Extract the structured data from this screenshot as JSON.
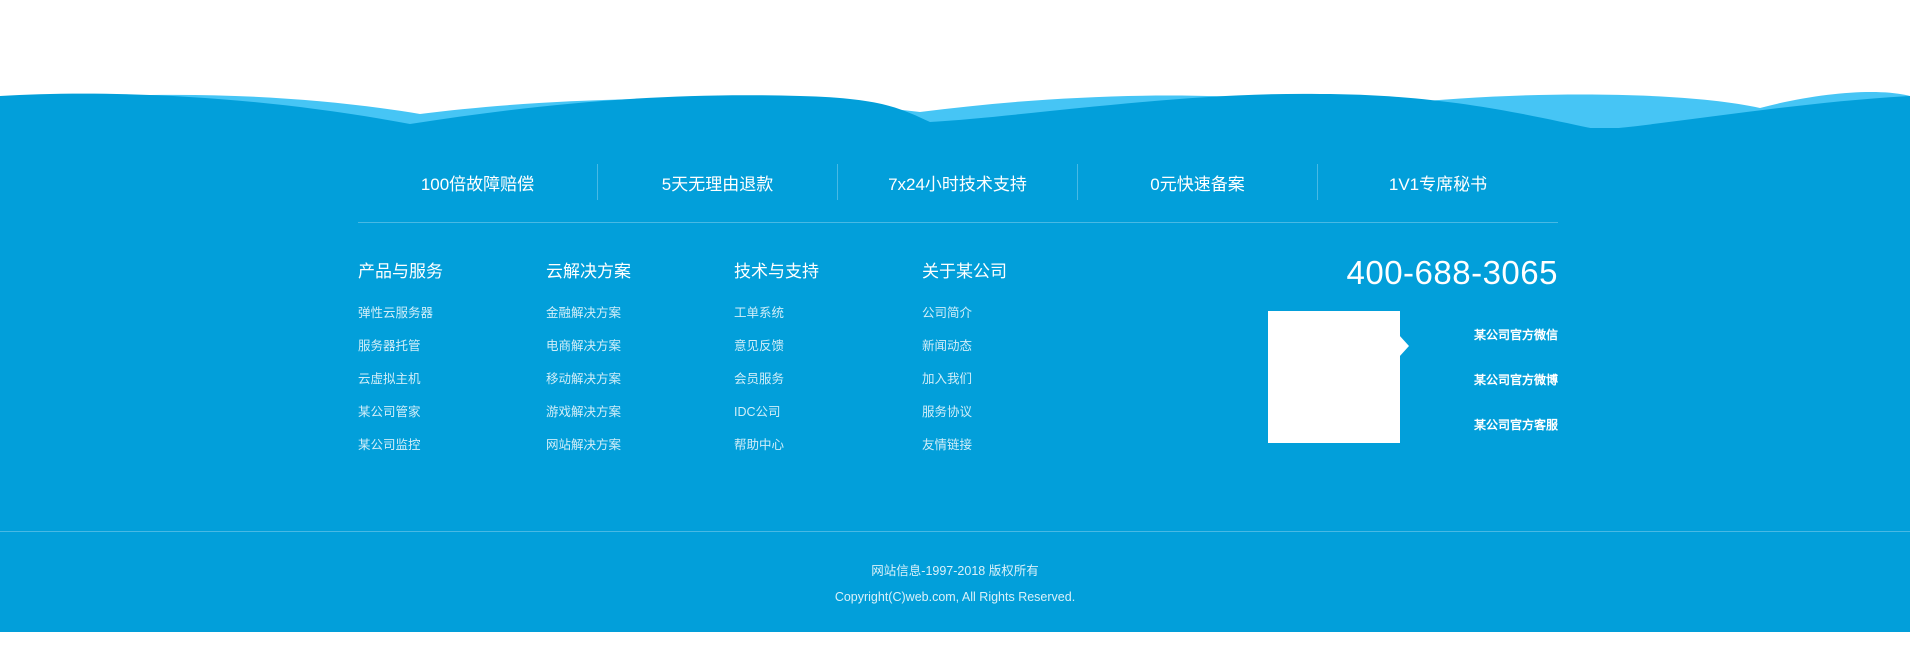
{
  "colors": {
    "background": "#ffffff",
    "footer": "#029fda",
    "wave_light": "#46c5f5",
    "text": "#ffffff"
  },
  "guarantees": [
    {
      "label": "100倍故障赔偿"
    },
    {
      "label": "5天无理由退款"
    },
    {
      "label": "7x24小时技术支持"
    },
    {
      "label": "0元快速备案"
    },
    {
      "label": "1V1专席秘书"
    }
  ],
  "link_columns": [
    {
      "title": "产品与服务",
      "items": [
        "弹性云服务器",
        "服务器托管",
        "云虚拟主机",
        "某公司管家",
        "某公司监控"
      ]
    },
    {
      "title": "云解决方案",
      "items": [
        "金融解决方案",
        "电商解决方案",
        "移动解决方案",
        "游戏解决方案",
        "网站解决方案"
      ]
    },
    {
      "title": "技术与支持",
      "items": [
        "工单系统",
        "意见反馈",
        "会员服务",
        "IDC公司",
        "帮助中心"
      ]
    },
    {
      "title": "关于某公司",
      "items": [
        "公司简介",
        "新闻动态",
        "加入我们",
        "服务协议",
        "友情链接"
      ]
    }
  ],
  "contact": {
    "phone": "400-688-3065",
    "social": [
      {
        "label": "某公司官方微信"
      },
      {
        "label": "某公司官方微博"
      },
      {
        "label": "某公司官方客服"
      }
    ]
  },
  "footer": {
    "line1": "网站信息-1997-2018 版权所有",
    "line2": "Copyright(C)web.com, All Rights Reserved."
  }
}
